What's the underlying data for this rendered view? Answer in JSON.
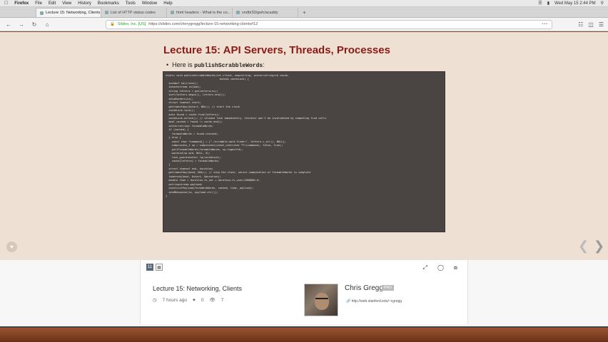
{
  "menubar": {
    "apple": "",
    "app": "Firefox",
    "items": [
      "File",
      "Edit",
      "View",
      "History",
      "Bookmarks",
      "Tools",
      "Window",
      "Help"
    ],
    "clock": "Wed May 15 2:44 PM"
  },
  "tabs": [
    {
      "label": "Lecture 15: Networking, Clients",
      "active": true
    },
    {
      "label": "List of HTTP status codes",
      "active": false
    },
    {
      "label": "html headers - What is the co...",
      "active": false
    },
    {
      "label": "vndb/33/gwh/acaddy",
      "active": false
    }
  ],
  "nav": {
    "site_label": "Slideo, Inc. [US]",
    "url": "https://slideo.com/cherygregg/lecture-15-networking-clients#12"
  },
  "slide": {
    "title": "Lecture 15: API Servers, Threads, Processes",
    "bullet_prefix": "Here is ",
    "bullet_code": "publishScrabbleWords",
    "bullet_suffix": ":",
    "code": "static void publishScrabbleWords(int client, map<string, vector<string>>& cache,\n                                   mutex& cacheLock) {\n  sockbuf sb(client);\n  iosockstream ss(&sb);\n  string letters = getLetters(ss);\n  sort(letters.begin(), letters.end());\n  skipHeaders(ss);\n  struct timeval start;\n  gettimeofday(&start, NULL); // start the clock\n  cacheLock.lock();\n  auto found = cache.find(letters);\n  cacheLock.unlock(); // release lock immediately, iterator won't be invalidated by competing find calls\n  bool cached = found != cache.end();\n  vector<string> formableWords;\n  if (cached) {\n    formableWords = found->second;\n  } else {\n    const char *command[] = {\"./scrabble-word-finder\", letters.c_str(), NULL};\n    subprocess_t sp = subprocess(const_cast<char **>(command), false, true);\n    pullFormableWords(formableWords, sp.ingestfd);\n    waitpid(sp.pid, NULL, 0);\n    lock_guard<mutex> lg(cacheLock);\n    cache[letters] = formableWords;\n  }\n  struct timeval end, duration;\n  gettimeofday(&end, NULL); // stop the clock, server-computation of formableWords is complete\n  timersub(&end, &start, &duration);\n  double time = duration.tv_sec + duration.tv_usec/1000000.0;\n  ostringstream payload;\n  constructPayload(formableWords, cached, time, payload);\n  sendResponse(ss, payload.str());\n}"
  },
  "lecture": {
    "title": "Lecture 15: Networking, Clients",
    "time_ago": "7 hours ago",
    "likes": "0",
    "views": "7",
    "page_indicator": "11"
  },
  "author": {
    "name": "Chris Gregg",
    "badge": "PRO",
    "url": "http://web.stanford.edu/~cgregg"
  },
  "colors": {
    "title_red": "#8b1a14",
    "code_bg": "#4a4542",
    "slide_bg": "#efe0d4"
  }
}
